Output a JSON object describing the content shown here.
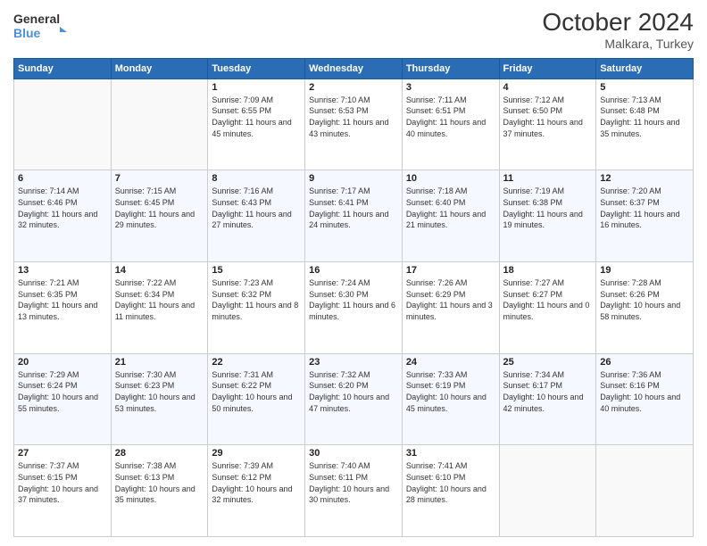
{
  "logo": {
    "line1": "General",
    "line2": "Blue"
  },
  "title": "October 2024",
  "subtitle": "Malkara, Turkey",
  "days_of_week": [
    "Sunday",
    "Monday",
    "Tuesday",
    "Wednesday",
    "Thursday",
    "Friday",
    "Saturday"
  ],
  "weeks": [
    [
      {
        "day": "",
        "info": ""
      },
      {
        "day": "",
        "info": ""
      },
      {
        "day": "1",
        "info": "Sunrise: 7:09 AM\nSunset: 6:55 PM\nDaylight: 11 hours and 45 minutes."
      },
      {
        "day": "2",
        "info": "Sunrise: 7:10 AM\nSunset: 6:53 PM\nDaylight: 11 hours and 43 minutes."
      },
      {
        "day": "3",
        "info": "Sunrise: 7:11 AM\nSunset: 6:51 PM\nDaylight: 11 hours and 40 minutes."
      },
      {
        "day": "4",
        "info": "Sunrise: 7:12 AM\nSunset: 6:50 PM\nDaylight: 11 hours and 37 minutes."
      },
      {
        "day": "5",
        "info": "Sunrise: 7:13 AM\nSunset: 6:48 PM\nDaylight: 11 hours and 35 minutes."
      }
    ],
    [
      {
        "day": "6",
        "info": "Sunrise: 7:14 AM\nSunset: 6:46 PM\nDaylight: 11 hours and 32 minutes."
      },
      {
        "day": "7",
        "info": "Sunrise: 7:15 AM\nSunset: 6:45 PM\nDaylight: 11 hours and 29 minutes."
      },
      {
        "day": "8",
        "info": "Sunrise: 7:16 AM\nSunset: 6:43 PM\nDaylight: 11 hours and 27 minutes."
      },
      {
        "day": "9",
        "info": "Sunrise: 7:17 AM\nSunset: 6:41 PM\nDaylight: 11 hours and 24 minutes."
      },
      {
        "day": "10",
        "info": "Sunrise: 7:18 AM\nSunset: 6:40 PM\nDaylight: 11 hours and 21 minutes."
      },
      {
        "day": "11",
        "info": "Sunrise: 7:19 AM\nSunset: 6:38 PM\nDaylight: 11 hours and 19 minutes."
      },
      {
        "day": "12",
        "info": "Sunrise: 7:20 AM\nSunset: 6:37 PM\nDaylight: 11 hours and 16 minutes."
      }
    ],
    [
      {
        "day": "13",
        "info": "Sunrise: 7:21 AM\nSunset: 6:35 PM\nDaylight: 11 hours and 13 minutes."
      },
      {
        "day": "14",
        "info": "Sunrise: 7:22 AM\nSunset: 6:34 PM\nDaylight: 11 hours and 11 minutes."
      },
      {
        "day": "15",
        "info": "Sunrise: 7:23 AM\nSunset: 6:32 PM\nDaylight: 11 hours and 8 minutes."
      },
      {
        "day": "16",
        "info": "Sunrise: 7:24 AM\nSunset: 6:30 PM\nDaylight: 11 hours and 6 minutes."
      },
      {
        "day": "17",
        "info": "Sunrise: 7:26 AM\nSunset: 6:29 PM\nDaylight: 11 hours and 3 minutes."
      },
      {
        "day": "18",
        "info": "Sunrise: 7:27 AM\nSunset: 6:27 PM\nDaylight: 11 hours and 0 minutes."
      },
      {
        "day": "19",
        "info": "Sunrise: 7:28 AM\nSunset: 6:26 PM\nDaylight: 10 hours and 58 minutes."
      }
    ],
    [
      {
        "day": "20",
        "info": "Sunrise: 7:29 AM\nSunset: 6:24 PM\nDaylight: 10 hours and 55 minutes."
      },
      {
        "day": "21",
        "info": "Sunrise: 7:30 AM\nSunset: 6:23 PM\nDaylight: 10 hours and 53 minutes."
      },
      {
        "day": "22",
        "info": "Sunrise: 7:31 AM\nSunset: 6:22 PM\nDaylight: 10 hours and 50 minutes."
      },
      {
        "day": "23",
        "info": "Sunrise: 7:32 AM\nSunset: 6:20 PM\nDaylight: 10 hours and 47 minutes."
      },
      {
        "day": "24",
        "info": "Sunrise: 7:33 AM\nSunset: 6:19 PM\nDaylight: 10 hours and 45 minutes."
      },
      {
        "day": "25",
        "info": "Sunrise: 7:34 AM\nSunset: 6:17 PM\nDaylight: 10 hours and 42 minutes."
      },
      {
        "day": "26",
        "info": "Sunrise: 7:36 AM\nSunset: 6:16 PM\nDaylight: 10 hours and 40 minutes."
      }
    ],
    [
      {
        "day": "27",
        "info": "Sunrise: 7:37 AM\nSunset: 6:15 PM\nDaylight: 10 hours and 37 minutes."
      },
      {
        "day": "28",
        "info": "Sunrise: 7:38 AM\nSunset: 6:13 PM\nDaylight: 10 hours and 35 minutes."
      },
      {
        "day": "29",
        "info": "Sunrise: 7:39 AM\nSunset: 6:12 PM\nDaylight: 10 hours and 32 minutes."
      },
      {
        "day": "30",
        "info": "Sunrise: 7:40 AM\nSunset: 6:11 PM\nDaylight: 10 hours and 30 minutes."
      },
      {
        "day": "31",
        "info": "Sunrise: 7:41 AM\nSunset: 6:10 PM\nDaylight: 10 hours and 28 minutes."
      },
      {
        "day": "",
        "info": ""
      },
      {
        "day": "",
        "info": ""
      }
    ]
  ]
}
